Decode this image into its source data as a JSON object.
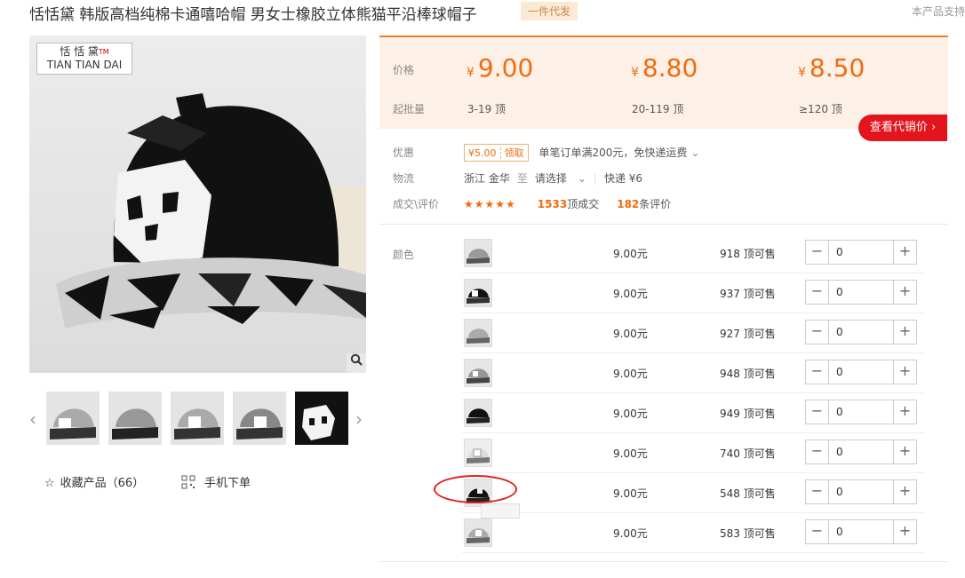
{
  "header": {
    "title": "恬恬黛 韩版高档纯棉卡通嘻哈帽 男女士橡胶立体熊猫平沿棒球帽子",
    "tag": "一件代发",
    "right_note": "本产品支持"
  },
  "gallery": {
    "brand_logo_line1": "恬 恬 黛",
    "brand_logo_tm": "TM",
    "brand_logo_line2": "TIAN TIAN DAI",
    "zoom_icon": "magnifier-icon",
    "prev_arrow": "‹",
    "next_arrow": "›"
  },
  "actions": {
    "favorite": "收藏产品（66）",
    "mobile_order": "手机下单"
  },
  "price_panel": {
    "price_label": "价格",
    "moq_label": "起批量",
    "currency": "¥",
    "tiers": [
      {
        "price": "9.00",
        "qty": "3-19 顶"
      },
      {
        "price": "8.80",
        "qty": "20-119 顶"
      },
      {
        "price": "8.50",
        "qty": "≥120 顶"
      }
    ],
    "agent_button": "查看代销价 ›",
    "accent_color": "#f26a0c"
  },
  "info": {
    "discount_label": "优惠",
    "coupon_value": "¥5.00",
    "coupon_action": "领取",
    "discount_text": "单笔订单满200元，免快递运费",
    "logistics_label": "物流",
    "origin": "浙江 金华",
    "to_word": "至",
    "destination_placeholder": "请选择",
    "shipping": "快递 ¥6",
    "deals_label": "成交\\评价",
    "rating_stars": 5,
    "deals_count": "1533",
    "deals_suffix": "顶成交",
    "reviews_count": "182",
    "reviews_suffix": "条评价"
  },
  "sku": {
    "label": "颜色",
    "rows": [
      {
        "price": "9.00元",
        "stock": "918",
        "stock_suffix": "顶可售",
        "qty": "0",
        "variant": "gray-cap"
      },
      {
        "price": "9.00元",
        "stock": "937",
        "stock_suffix": "顶可售",
        "qty": "0",
        "variant": "black-cap"
      },
      {
        "price": "9.00元",
        "stock": "927",
        "stock_suffix": "顶可售",
        "qty": "0",
        "variant": "gray-cap"
      },
      {
        "price": "9.00元",
        "stock": "948",
        "stock_suffix": "顶可售",
        "qty": "0",
        "variant": "gray-cap"
      },
      {
        "price": "9.00元",
        "stock": "949",
        "stock_suffix": "顶可售",
        "qty": "0",
        "variant": "black-cap"
      },
      {
        "price": "9.00元",
        "stock": "740",
        "stock_suffix": "顶可售",
        "qty": "0",
        "variant": "white-cap"
      },
      {
        "price": "9.00元",
        "stock": "548",
        "stock_suffix": "顶可售",
        "qty": "0",
        "variant": "black-cap"
      },
      {
        "price": "9.00元",
        "stock": "583",
        "stock_suffix": "顶可售",
        "qty": "0",
        "variant": "gray-cap"
      }
    ]
  }
}
